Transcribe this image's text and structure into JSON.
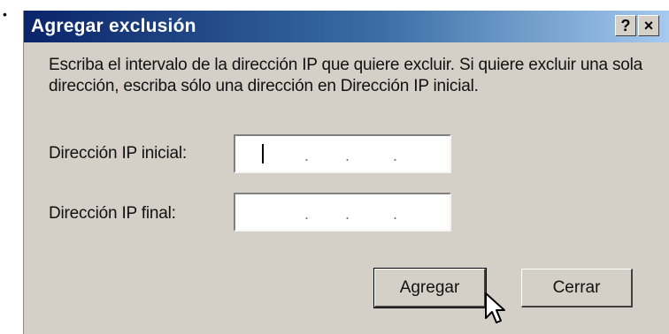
{
  "page": {
    "bullet": "•"
  },
  "dialog": {
    "title": "Agregar exclusión",
    "help_button": "?",
    "close_button": "×",
    "message": "Escriba el intervalo de la dirección IP que quiere excluir. Si quiere excluir una sola dirección, escriba sólo una dirección en Dirección IP inicial.",
    "start_ip": {
      "label": "Dirección IP inicial:",
      "value": "",
      "separator": "."
    },
    "end_ip": {
      "label": "Dirección IP final:",
      "value": "",
      "separator": "."
    },
    "buttons": {
      "add": "Agregar",
      "close": "Cerrar"
    }
  },
  "colors": {
    "titlebar_start": "#0a246a",
    "titlebar_end": "#a6caf0",
    "dialog_face": "#d4d0c8"
  },
  "icons": {
    "pointer": "arrow-cursor-icon"
  }
}
